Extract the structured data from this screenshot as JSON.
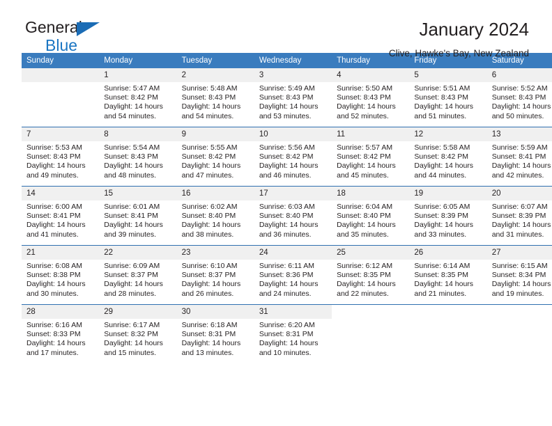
{
  "brand": {
    "word1": "General",
    "word2": "Blue"
  },
  "header": {
    "title": "January 2024",
    "subtitle": "Clive, Hawke's Bay, New Zealand"
  },
  "colors": {
    "header_blue": "#3a7cbe",
    "rule_blue": "#2f6fb0",
    "daynum_gray": "#f0f0f0",
    "brand_blue": "#1b76c3",
    "text": "#231f20"
  },
  "weekdays": [
    "Sunday",
    "Monday",
    "Tuesday",
    "Wednesday",
    "Thursday",
    "Friday",
    "Saturday"
  ],
  "labels": {
    "sunrise": "Sunrise:",
    "sunset": "Sunset:",
    "daylight": "Daylight:"
  },
  "weeks": [
    [
      {
        "day": "",
        "lines": []
      },
      {
        "day": "1",
        "lines": [
          "Sunrise: 5:47 AM",
          "Sunset: 8:42 PM",
          "Daylight: 14 hours",
          "and 54 minutes."
        ]
      },
      {
        "day": "2",
        "lines": [
          "Sunrise: 5:48 AM",
          "Sunset: 8:43 PM",
          "Daylight: 14 hours",
          "and 54 minutes."
        ]
      },
      {
        "day": "3",
        "lines": [
          "Sunrise: 5:49 AM",
          "Sunset: 8:43 PM",
          "Daylight: 14 hours",
          "and 53 minutes."
        ]
      },
      {
        "day": "4",
        "lines": [
          "Sunrise: 5:50 AM",
          "Sunset: 8:43 PM",
          "Daylight: 14 hours",
          "and 52 minutes."
        ]
      },
      {
        "day": "5",
        "lines": [
          "Sunrise: 5:51 AM",
          "Sunset: 8:43 PM",
          "Daylight: 14 hours",
          "and 51 minutes."
        ]
      },
      {
        "day": "6",
        "lines": [
          "Sunrise: 5:52 AM",
          "Sunset: 8:43 PM",
          "Daylight: 14 hours",
          "and 50 minutes."
        ]
      }
    ],
    [
      {
        "day": "7",
        "lines": [
          "Sunrise: 5:53 AM",
          "Sunset: 8:43 PM",
          "Daylight: 14 hours",
          "and 49 minutes."
        ]
      },
      {
        "day": "8",
        "lines": [
          "Sunrise: 5:54 AM",
          "Sunset: 8:43 PM",
          "Daylight: 14 hours",
          "and 48 minutes."
        ]
      },
      {
        "day": "9",
        "lines": [
          "Sunrise: 5:55 AM",
          "Sunset: 8:42 PM",
          "Daylight: 14 hours",
          "and 47 minutes."
        ]
      },
      {
        "day": "10",
        "lines": [
          "Sunrise: 5:56 AM",
          "Sunset: 8:42 PM",
          "Daylight: 14 hours",
          "and 46 minutes."
        ]
      },
      {
        "day": "11",
        "lines": [
          "Sunrise: 5:57 AM",
          "Sunset: 8:42 PM",
          "Daylight: 14 hours",
          "and 45 minutes."
        ]
      },
      {
        "day": "12",
        "lines": [
          "Sunrise: 5:58 AM",
          "Sunset: 8:42 PM",
          "Daylight: 14 hours",
          "and 44 minutes."
        ]
      },
      {
        "day": "13",
        "lines": [
          "Sunrise: 5:59 AM",
          "Sunset: 8:41 PM",
          "Daylight: 14 hours",
          "and 42 minutes."
        ]
      }
    ],
    [
      {
        "day": "14",
        "lines": [
          "Sunrise: 6:00 AM",
          "Sunset: 8:41 PM",
          "Daylight: 14 hours",
          "and 41 minutes."
        ]
      },
      {
        "day": "15",
        "lines": [
          "Sunrise: 6:01 AM",
          "Sunset: 8:41 PM",
          "Daylight: 14 hours",
          "and 39 minutes."
        ]
      },
      {
        "day": "16",
        "lines": [
          "Sunrise: 6:02 AM",
          "Sunset: 8:40 PM",
          "Daylight: 14 hours",
          "and 38 minutes."
        ]
      },
      {
        "day": "17",
        "lines": [
          "Sunrise: 6:03 AM",
          "Sunset: 8:40 PM",
          "Daylight: 14 hours",
          "and 36 minutes."
        ]
      },
      {
        "day": "18",
        "lines": [
          "Sunrise: 6:04 AM",
          "Sunset: 8:40 PM",
          "Daylight: 14 hours",
          "and 35 minutes."
        ]
      },
      {
        "day": "19",
        "lines": [
          "Sunrise: 6:05 AM",
          "Sunset: 8:39 PM",
          "Daylight: 14 hours",
          "and 33 minutes."
        ]
      },
      {
        "day": "20",
        "lines": [
          "Sunrise: 6:07 AM",
          "Sunset: 8:39 PM",
          "Daylight: 14 hours",
          "and 31 minutes."
        ]
      }
    ],
    [
      {
        "day": "21",
        "lines": [
          "Sunrise: 6:08 AM",
          "Sunset: 8:38 PM",
          "Daylight: 14 hours",
          "and 30 minutes."
        ]
      },
      {
        "day": "22",
        "lines": [
          "Sunrise: 6:09 AM",
          "Sunset: 8:37 PM",
          "Daylight: 14 hours",
          "and 28 minutes."
        ]
      },
      {
        "day": "23",
        "lines": [
          "Sunrise: 6:10 AM",
          "Sunset: 8:37 PM",
          "Daylight: 14 hours",
          "and 26 minutes."
        ]
      },
      {
        "day": "24",
        "lines": [
          "Sunrise: 6:11 AM",
          "Sunset: 8:36 PM",
          "Daylight: 14 hours",
          "and 24 minutes."
        ]
      },
      {
        "day": "25",
        "lines": [
          "Sunrise: 6:12 AM",
          "Sunset: 8:35 PM",
          "Daylight: 14 hours",
          "and 22 minutes."
        ]
      },
      {
        "day": "26",
        "lines": [
          "Sunrise: 6:14 AM",
          "Sunset: 8:35 PM",
          "Daylight: 14 hours",
          "and 21 minutes."
        ]
      },
      {
        "day": "27",
        "lines": [
          "Sunrise: 6:15 AM",
          "Sunset: 8:34 PM",
          "Daylight: 14 hours",
          "and 19 minutes."
        ]
      }
    ],
    [
      {
        "day": "28",
        "lines": [
          "Sunrise: 6:16 AM",
          "Sunset: 8:33 PM",
          "Daylight: 14 hours",
          "and 17 minutes."
        ]
      },
      {
        "day": "29",
        "lines": [
          "Sunrise: 6:17 AM",
          "Sunset: 8:32 PM",
          "Daylight: 14 hours",
          "and 15 minutes."
        ]
      },
      {
        "day": "30",
        "lines": [
          "Sunrise: 6:18 AM",
          "Sunset: 8:31 PM",
          "Daylight: 14 hours",
          "and 13 minutes."
        ]
      },
      {
        "day": "31",
        "lines": [
          "Sunrise: 6:20 AM",
          "Sunset: 8:31 PM",
          "Daylight: 14 hours",
          "and 10 minutes."
        ]
      },
      {
        "day": "",
        "lines": []
      },
      {
        "day": "",
        "lines": []
      },
      {
        "day": "",
        "lines": []
      }
    ]
  ]
}
